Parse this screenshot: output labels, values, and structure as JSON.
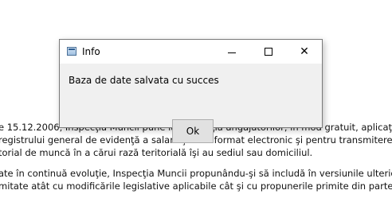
{
  "background_document": {
    "paragraphs": [
      {
        "lines": [
          "e 15.12.2006, Inspecţia Muncii pune la dispoziţia angajatorilor, în mod gratuit, aplicaţia REVISAL",
          "registrului general de evidenţă a salariaţilor în format electronic şi pentru transmiterea acestui",
          "torial de muncă în a cărui rază teritorială îşi au sediul sau domiciliul."
        ]
      },
      {
        "lines": [
          "ate în continuă evoluţie, Inspecţia Muncii propunându-şi să includă în versiunile ulterioare",
          "mitate atât cu modificările legislative aplicabile cât şi cu propunerile primite din partea angaja"
        ]
      }
    ]
  },
  "dialog": {
    "title": "Info",
    "message": "Baza de date salvata cu succes",
    "ok_label": "Ok",
    "close_glyph": "✕"
  },
  "icons": {
    "app": "window-app-icon",
    "minimize": "minimize-icon",
    "maximize": "maximize-icon",
    "close": "close-icon"
  }
}
